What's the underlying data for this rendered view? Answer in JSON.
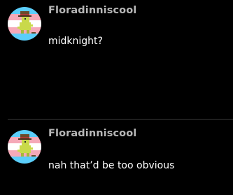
{
  "posts": [
    {
      "username": "Floradinniscool",
      "message": "midknight?",
      "avatar_icon": "trans-flag-dinosaur-avatar"
    },
    {
      "username": "Floradinniscool",
      "message": "nah that’d be too obvious",
      "avatar_icon": "trans-flag-dinosaur-avatar"
    }
  ],
  "colors": {
    "background": "#000000",
    "username": "#b7b7b7",
    "message": "#ffffff",
    "divider": "#3a3a3a",
    "flag_blue": "#5bcefa",
    "flag_pink": "#f5a9b8",
    "flag_white": "#ffffff"
  }
}
